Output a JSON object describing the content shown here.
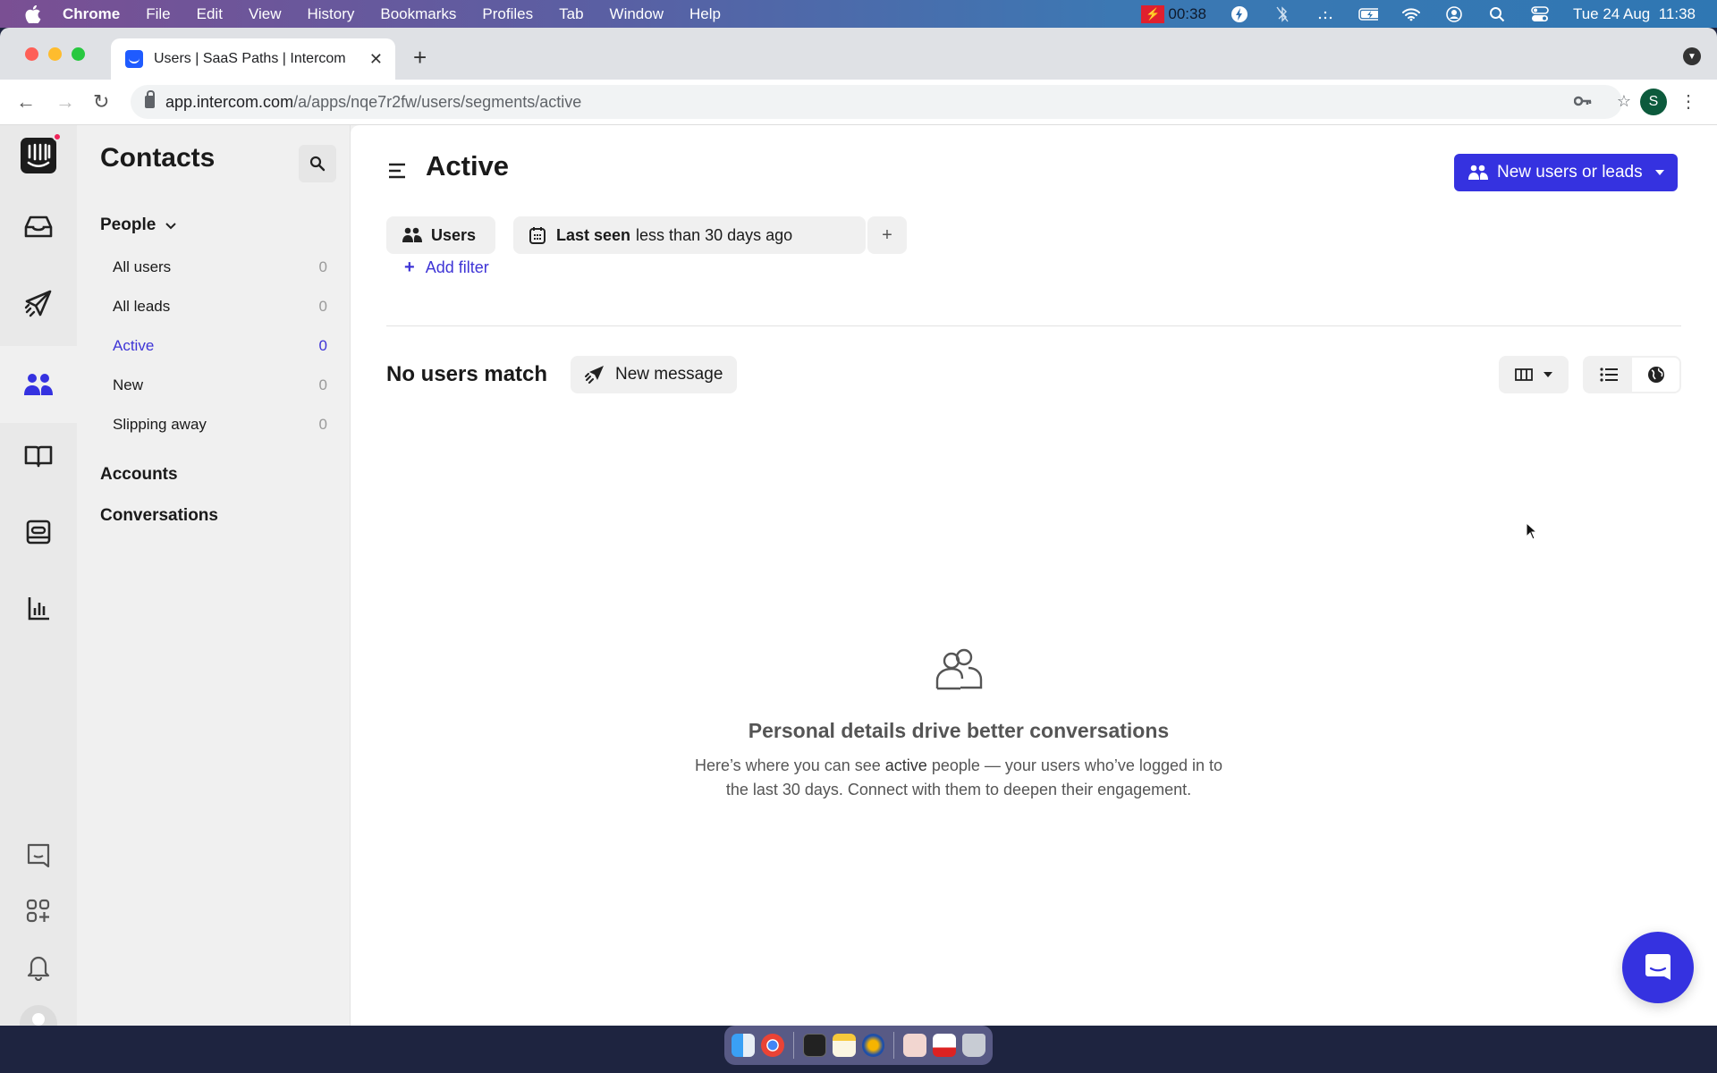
{
  "menubar": {
    "app": "Chrome",
    "items": [
      "File",
      "Edit",
      "View",
      "History",
      "Bookmarks",
      "Profiles",
      "Tab",
      "Window",
      "Help"
    ],
    "recording_time": "00:38",
    "datetime": "Tue 24 Aug  11:38"
  },
  "browser": {
    "tab_title": "Users | SaaS Paths | Intercom",
    "url_host": "app.intercom.com",
    "url_path": "/a/apps/nqe7r2fw/users/segments/active",
    "profile_initial": "S"
  },
  "sidebar": {
    "title": "Contacts",
    "people_label": "People",
    "items": [
      {
        "label": "All users",
        "count": "0"
      },
      {
        "label": "All leads",
        "count": "0"
      },
      {
        "label": "Active",
        "count": "0"
      },
      {
        "label": "New",
        "count": "0"
      },
      {
        "label": "Slipping away",
        "count": "0"
      }
    ],
    "accounts_label": "Accounts",
    "conversations_label": "Conversations"
  },
  "main": {
    "title": "Active",
    "primary_button": "New users or leads",
    "filters": {
      "type_chip": "Users",
      "rule_key": "Last seen",
      "rule_value": "less than 30 days ago",
      "add_filter": "Add filter"
    },
    "result_heading": "No users match",
    "new_message": "New message",
    "empty": {
      "heading": "Personal details drive better conversations",
      "line1_pre": "Here’s where you can see ",
      "line1_bold": "active",
      "line1_post": " people — your users who’ve logged in to",
      "line2": "the last 30 days. Connect with them to deepen their engagement."
    }
  },
  "colors": {
    "accent": "#3532e0",
    "active_link": "#3e34d6"
  }
}
